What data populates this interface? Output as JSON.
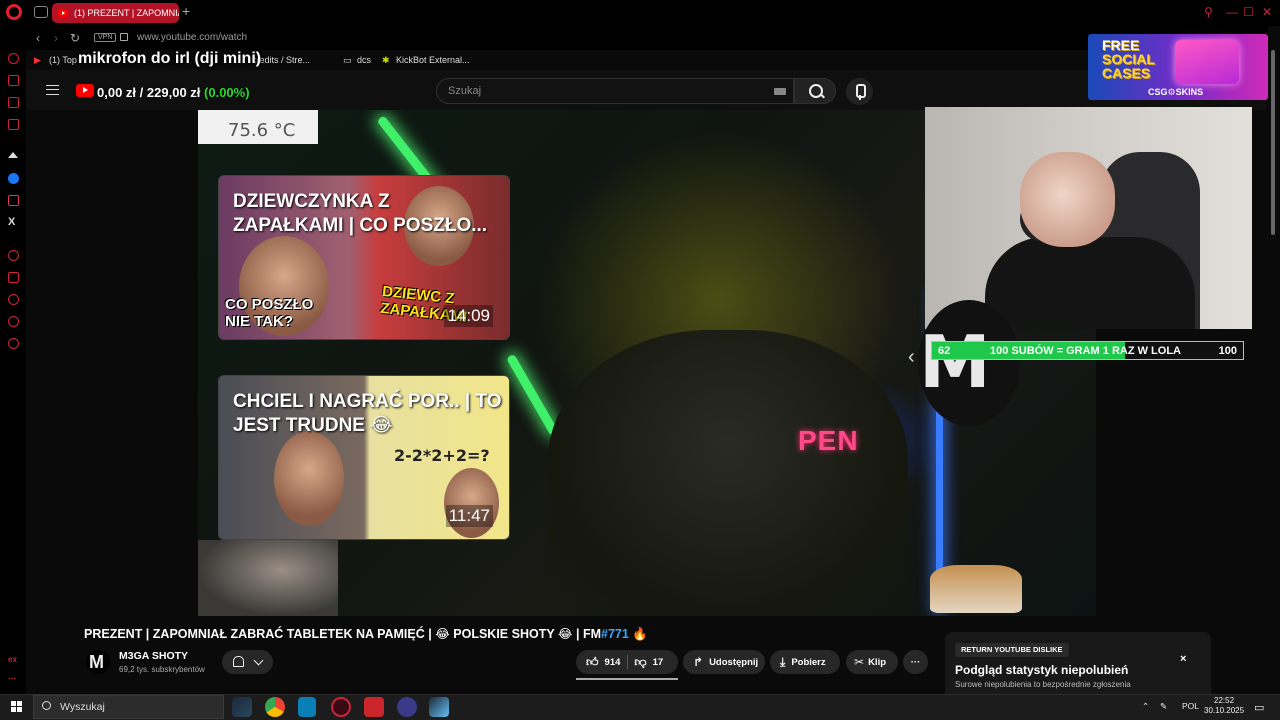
{
  "browser": {
    "tab_title": "(1) PREZENT | ZAPOMNIA",
    "url": "www.youtube.com/watch",
    "vpn_label": "VPN",
    "bookmarks": [
      "(1) Top",
      "credits / Stre...",
      "dcs",
      "KickBot External..."
    ]
  },
  "sidebar": {
    "bottom_text": "ex"
  },
  "youtube": {
    "search_placeholder": "Szukaj"
  },
  "overlay": {
    "mic_text": "mikrofon do irl (dji mini)",
    "money_current": "0,00 zł",
    "money_separator": "/",
    "money_goal": "229,00 zł",
    "money_pct": "(0.00%)",
    "temperature": "75.6 °C",
    "sign_text": "PEN"
  },
  "thumbnails": [
    {
      "title": "DZIEWCZYNKA Z ZAPAŁKAMI | CO POSZŁO...",
      "sub_left": "CO POSZŁO NIE TAK?",
      "sub_right": "DZIEWC Z ZAPAŁKAMI",
      "duration": "14:09"
    },
    {
      "title": "CHCIEL I NAGRAĆ POR.. | TO JEST TRUDNE 😂",
      "math": "2-2*2+2=?",
      "duration": "11:47"
    }
  ],
  "goal": {
    "current": "62",
    "label": "100 SUBÓW = GRAM 1 RAZ W LOLA",
    "target": "100",
    "progress_fraction": 0.62
  },
  "ad": {
    "line1": "FREE",
    "line2": "SOCIAL",
    "line3": "CASES",
    "brand": "CSG⚙SKINS"
  },
  "video": {
    "title_main": "PREZENT | ZAPOMNIAŁ ZABRAĆ TABLETEK NA PAMIĘĆ | 😂 POLSKIE SHOTY 😂 | FM",
    "title_tag": "#771",
    "title_end": " 🔥",
    "channel_name": "M3GA SHOTY",
    "channel_subs": "69,2 tys. subskrybentów",
    "likes": "914",
    "dislikes": "17",
    "share_label": "Udostępnij",
    "download_label": "Pobierz",
    "clip_label": "Klip",
    "more_label": "···"
  },
  "ryd": {
    "badge": "RETURN YOUTUBE DISLIKE",
    "title": "Podgląd statystyk niepolubień",
    "desc": "Surowe niepolubienia to bezpośrednie zgłoszenia",
    "close": "×"
  },
  "taskbar": {
    "search_label": "Wyszukaj",
    "language": "POL",
    "time": "22:52",
    "date": "30.10.2025"
  },
  "colors": {
    "opera_red": "#d3203a",
    "youtube_red": "#ff0000",
    "goal_green": "#1fc84a",
    "link_blue": "#3ea6ff"
  }
}
